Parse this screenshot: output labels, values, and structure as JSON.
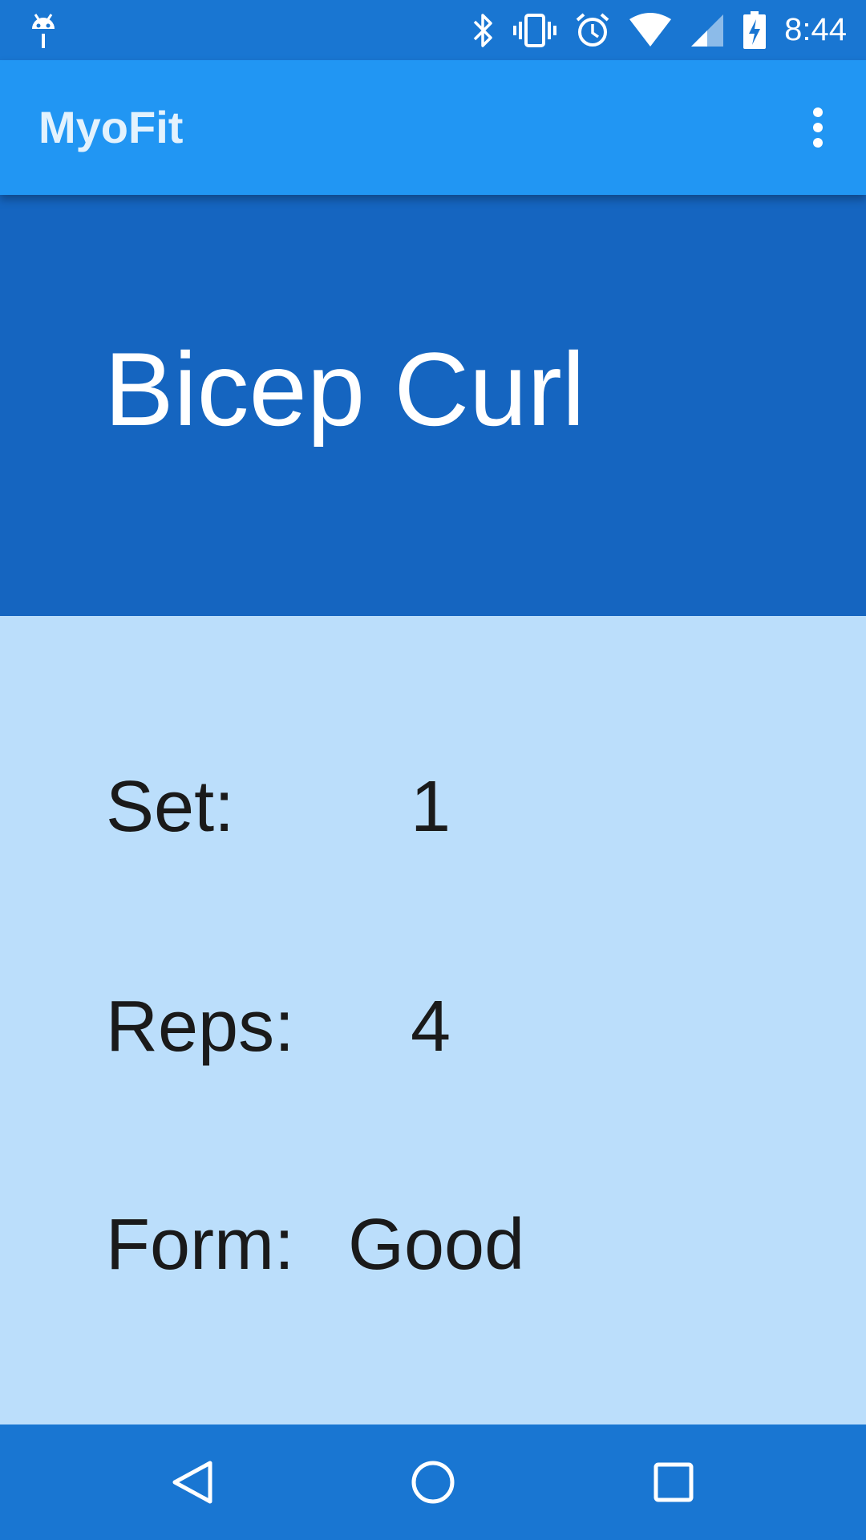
{
  "status_bar": {
    "time": "8:44",
    "icons": [
      "android-debug-icon",
      "bluetooth-icon",
      "vibrate-icon",
      "alarm-icon",
      "wifi-icon",
      "cell-signal-icon",
      "battery-charging-icon"
    ]
  },
  "app_bar": {
    "title": "MyoFit",
    "menu_icon": "overflow-menu-icon"
  },
  "exercise": {
    "name": "Bicep Curl"
  },
  "stats": {
    "set_label": "Set:",
    "set_value": "1",
    "reps_label": "Reps:",
    "reps_value": "4",
    "form_label": "Form:",
    "form_value": "Good"
  },
  "nav_bar": {
    "icons": [
      "back-icon",
      "home-icon",
      "recents-icon"
    ]
  },
  "colors": {
    "status_bar": "#1976D2",
    "app_bar": "#2196F3",
    "header": "#1565C0",
    "content_bg": "#BBDEFB",
    "nav_bar": "#1976D2"
  }
}
